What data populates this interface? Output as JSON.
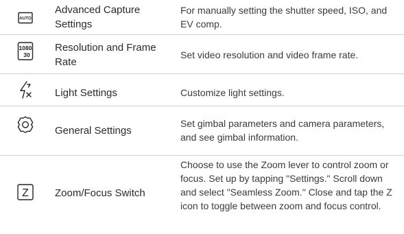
{
  "rows": [
    {
      "icon": "auto-mode-icon",
      "icon_text": "AUTO",
      "name": "Advanced Capture Settings",
      "description": "For manually setting the shutter speed, ISO, and EV comp."
    },
    {
      "icon": "resolution-icon",
      "icon_text_top": "1080",
      "icon_text_bottom": "30",
      "name": "Resolution and Frame Rate",
      "description": "Set video resolution and video frame rate."
    },
    {
      "icon": "light-off-icon",
      "name": "Light Settings",
      "description": "Customize light settings."
    },
    {
      "icon": "gear-icon",
      "name": "General Settings",
      "description": "Set gimbal parameters and camera parameters, and see gimbal information."
    },
    {
      "icon": "zoom-focus-icon",
      "icon_text": "Z",
      "name": "Zoom/Focus Switch",
      "description": "Choose to use the Zoom lever to control zoom or focus. Set up by tapping \"Settings.\" Scroll down and select \"Seamless Zoom.\" Close and tap the Z icon to toggle between zoom and focus control."
    }
  ]
}
